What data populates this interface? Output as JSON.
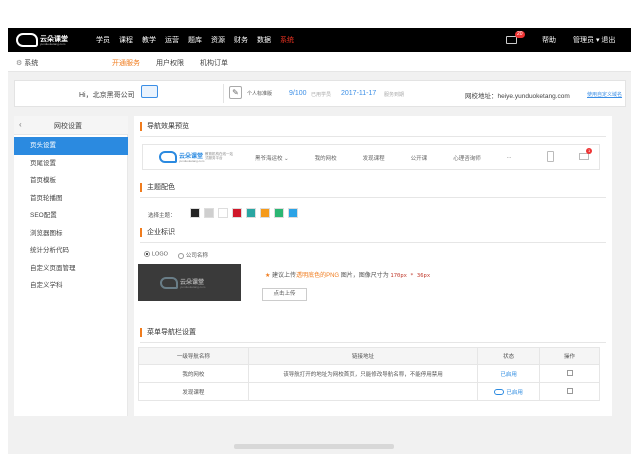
{
  "topbar": {
    "logo_name": "云朵课堂",
    "logo_sub": "yunduoketang.com",
    "nav": [
      "学员",
      "课程",
      "教学",
      "运营",
      "题库",
      "资源",
      "财务",
      "数据",
      "系统"
    ],
    "nav_active": "系统",
    "badge": "20",
    "help": "帮助",
    "admin": "管理员 ▾  退出"
  },
  "subbar": {
    "system": "系统",
    "tabs": [
      "开通服务",
      "用户权限",
      "机构订单"
    ],
    "active_tab": "开通服务"
  },
  "info": {
    "greeting": "Hi，北京黑哥公司",
    "version": "个人标准版",
    "count": "9/100",
    "count_label": "已用学员",
    "date": "2017-11-17",
    "date_label": "服务到期",
    "site": "网校地址：heiye.yunduoketang.com",
    "site_link": "使用自定义域名"
  },
  "sidebar": {
    "back": "‹",
    "title": "网校设置",
    "items": [
      "页头设置",
      "页尾设置",
      "首页模板",
      "首页轮播图",
      "SEO配置",
      "浏览器图标",
      "统计分析代码",
      "自定义页面管理",
      "自定义学科"
    ],
    "active": "页头设置"
  },
  "main": {
    "sec_preview": "导航效果预览",
    "sec_theme": "主题配色",
    "sec_brand": "企业标识",
    "sec_menu": "菜单导航栏设置",
    "preview": {
      "logo_name": "云朵课堂",
      "logo_sub": "yunduoketang.com",
      "logo_desc": "教育机构在线一站式服务平台",
      "nav": [
        "黑爷海运校 ⌄",
        "我的网校",
        "发现课程",
        "公开课",
        "心理咨询师",
        "..."
      ],
      "mail_badge": "1"
    },
    "theme_label": "选择主题：",
    "colors": [
      "#222222",
      "#cfcfcf",
      "#ffffff",
      "#d0182a",
      "#2aa6a2",
      "#f59a1a",
      "#2bb673",
      "#2ba3e6"
    ],
    "radio_logo": "LOGO",
    "radio_company": "公司名称",
    "brand_logo_name": "云朵课堂",
    "brand_logo_sub": "yunduoketang.com",
    "tip_star": "★",
    "tip_pre": " 建议上传",
    "tip_or": "透明底色的PNG",
    "tip_mid": " 图片，图像尺寸为 ",
    "tip_size": "170px * 36px",
    "upload": "点击上传",
    "table": {
      "headers": [
        "一级导航名称",
        "链接地址",
        "状态",
        "操作"
      ],
      "rows": [
        {
          "name": "我的网校",
          "link": "该导航打开的地址为网校首页，只能修改导航名称，不能停用禁用",
          "status": "已启用"
        },
        {
          "name": "发现课程",
          "link": "",
          "status": "已启用"
        }
      ]
    }
  }
}
